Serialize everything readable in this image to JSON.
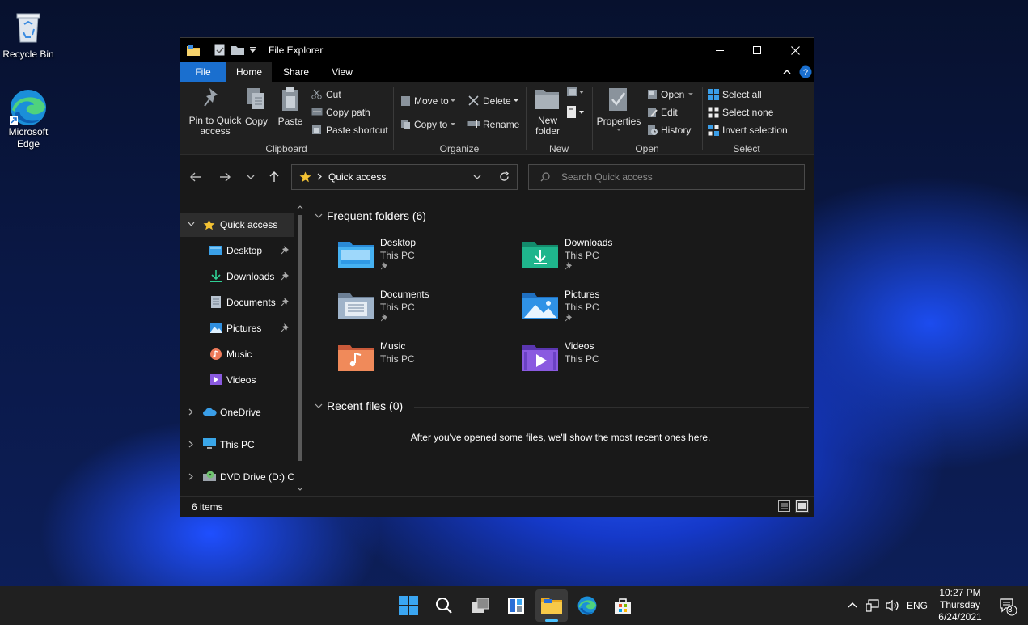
{
  "desktop": {
    "icons": [
      {
        "label": "Recycle Bin"
      },
      {
        "label_line1": "Microsoft",
        "label_line2": "Edge"
      }
    ]
  },
  "window": {
    "title": "File Explorer",
    "tabs": [
      "File",
      "Home",
      "Share",
      "View"
    ],
    "ribbon": {
      "clipboard": {
        "group": "Clipboard",
        "pin_line1": "Pin to Quick",
        "pin_line2": "access",
        "copy": "Copy",
        "paste": "Paste",
        "cut": "Cut",
        "copy_path": "Copy path",
        "paste_shortcut": "Paste shortcut"
      },
      "organize": {
        "group": "Organize",
        "move_to": "Move to",
        "copy_to": "Copy to",
        "delete": "Delete",
        "rename": "Rename"
      },
      "new": {
        "group": "New",
        "folder_line1": "New",
        "folder_line2": "folder"
      },
      "open": {
        "group": "Open",
        "properties": "Properties",
        "open": "Open",
        "edit": "Edit",
        "history": "History"
      },
      "select": {
        "group": "Select",
        "select_all": "Select all",
        "select_none": "Select none",
        "invert": "Invert selection"
      }
    },
    "address": {
      "path": "Quick access",
      "search_placeholder": "Search Quick access"
    },
    "sidebar": [
      {
        "label": "Quick access",
        "icon": "star-icon"
      },
      {
        "label": "Desktop",
        "icon": "desktop-icon",
        "pinned": true
      },
      {
        "label": "Downloads",
        "icon": "download-icon",
        "pinned": true
      },
      {
        "label": "Documents",
        "icon": "document-icon",
        "pinned": true
      },
      {
        "label": "Pictures",
        "icon": "picture-icon",
        "pinned": true
      },
      {
        "label": "Music",
        "icon": "music-icon"
      },
      {
        "label": "Videos",
        "icon": "video-icon"
      },
      {
        "label": "OneDrive",
        "icon": "cloud-icon"
      },
      {
        "label": "This PC",
        "icon": "computer-icon"
      },
      {
        "label": "DVD Drive (D:) CC",
        "icon": "dvd-icon"
      }
    ],
    "frequent": {
      "title": "Frequent folders (6)",
      "folders": [
        {
          "name": "Desktop",
          "location": "This PC",
          "pinned": true,
          "color": "#3aa0e8"
        },
        {
          "name": "Downloads",
          "location": "This PC",
          "pinned": true,
          "color": "#1fa88a"
        },
        {
          "name": "Documents",
          "location": "This PC",
          "pinned": true,
          "color": "#8ca4c4"
        },
        {
          "name": "Pictures",
          "location": "This PC",
          "pinned": true,
          "color": "#2f8fe0"
        },
        {
          "name": "Music",
          "location": "This PC",
          "pinned": false,
          "color": "#f08a5a"
        },
        {
          "name": "Videos",
          "location": "This PC",
          "pinned": false,
          "color": "#8a5ae0"
        }
      ]
    },
    "recent": {
      "title": "Recent files (0)",
      "empty_message": "After you've opened some files, we'll show the most recent ones here."
    },
    "status": {
      "items": "6 items"
    }
  },
  "taskbar": {
    "language": "ENG",
    "time": "10:27 PM",
    "day": "Thursday",
    "date": "6/24/2021",
    "notifications": "3"
  }
}
